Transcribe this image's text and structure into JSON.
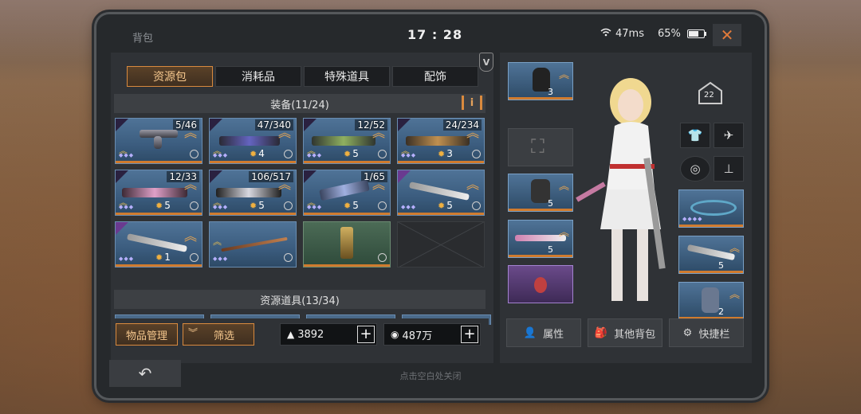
{
  "status": {
    "title": "背包",
    "time": "17 : 28",
    "signal": "47ms",
    "battery": "65%"
  },
  "tabs": [
    {
      "label": "资源包",
      "active": true
    },
    {
      "label": "消耗品"
    },
    {
      "label": "特殊道具"
    },
    {
      "label": "配饰"
    }
  ],
  "equipment_header": "装备(11/24)",
  "resource_header": "资源道具(13/34)",
  "items": [
    {
      "count": "5/46",
      "level": "",
      "type": "revolver"
    },
    {
      "count": "47/340",
      "level": "4",
      "type": "rifle"
    },
    {
      "count": "12/52",
      "level": "5",
      "type": "rifle"
    },
    {
      "count": "24/234",
      "level": "3",
      "type": "rifle"
    },
    {
      "count": "12/33",
      "level": "5",
      "type": "pink-gun"
    },
    {
      "count": "106/517",
      "level": "5",
      "type": "rifle"
    },
    {
      "count": "1/65",
      "level": "5",
      "type": "crossbow"
    },
    {
      "count": "",
      "level": "5",
      "type": "blade"
    },
    {
      "count": "",
      "level": "1",
      "type": "blade"
    },
    {
      "count": "",
      "level": "",
      "type": "staff"
    },
    {
      "count": "",
      "level": "",
      "type": "totem",
      "green": true
    },
    {
      "count": "",
      "level": "",
      "type": "empty",
      "empty": true
    }
  ],
  "buttons": {
    "manage": "物品管理",
    "filter": "筛选"
  },
  "currency": {
    "gold": "3892",
    "coins": "487万"
  },
  "right": {
    "badge": "22",
    "eq_levels": [
      "3",
      "5",
      "5",
      "5",
      "2"
    ],
    "attr": "属性",
    "other_bag": "其他背包",
    "shortcut": "快捷栏"
  },
  "hint": "点击空白处关闭"
}
